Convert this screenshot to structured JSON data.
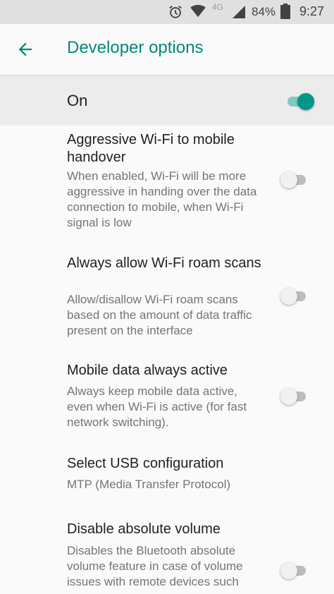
{
  "status_bar": {
    "network": "4G",
    "battery": "84%",
    "time": "9:27"
  },
  "app_bar": {
    "title": "Developer options"
  },
  "master_switch": {
    "label": "On",
    "checked": true
  },
  "prefs": [
    {
      "title": "Aggressive Wi-Fi to mobile handover",
      "summary": "When enabled, Wi-Fi will be more aggressive in handing over the data connection to mobile, when Wi-Fi signal is low",
      "checked": false
    },
    {
      "title": "Always allow Wi-Fi roam scans",
      "summary": "Allow/disallow Wi-Fi roam scans based on the amount of data traffic present on the interface",
      "checked": false
    },
    {
      "title": "Mobile data always active",
      "summary": "Always keep mobile data active, even when Wi-Fi is active (for fast network switching).",
      "checked": false
    },
    {
      "title": "Select USB configuration",
      "summary": "MTP (Media Transfer Protocol)"
    },
    {
      "title": "Disable absolute volume",
      "summary": "Disables the Bluetooth absolute volume feature in case of volume issues with remote devices such",
      "checked": false
    }
  ],
  "colors": {
    "accent": "#009688",
    "title": "#00897b"
  }
}
